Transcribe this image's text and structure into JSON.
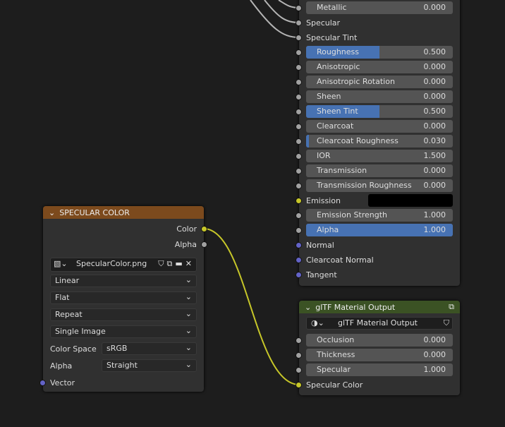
{
  "colors": {
    "grey_socket": "#a1a1a1",
    "yellow_socket": "#c7c729",
    "blue_socket": "#6363c7",
    "value_fill": "#4772b3",
    "image_header": "#7c4a1d",
    "output_header": "#3b5224"
  },
  "bsdf": {
    "rows": [
      {
        "label": "Metallic",
        "type": "field",
        "value": "0.000",
        "fill": 0,
        "socket": "grey"
      },
      {
        "label": "Specular",
        "type": "label",
        "socket": "grey"
      },
      {
        "label": "Specular Tint",
        "type": "label",
        "socket": "grey"
      },
      {
        "label": "Roughness",
        "type": "field",
        "value": "0.500",
        "fill": 0.5,
        "socket": "grey"
      },
      {
        "label": "Anisotropic",
        "type": "field",
        "value": "0.000",
        "fill": 0,
        "socket": "grey"
      },
      {
        "label": "Anisotropic Rotation",
        "type": "field",
        "value": "0.000",
        "fill": 0,
        "socket": "grey"
      },
      {
        "label": "Sheen",
        "type": "field",
        "value": "0.000",
        "fill": 0,
        "socket": "grey"
      },
      {
        "label": "Sheen Tint",
        "type": "field",
        "value": "0.500",
        "fill": 0.5,
        "socket": "grey"
      },
      {
        "label": "Clearcoat",
        "type": "field",
        "value": "0.000",
        "fill": 0,
        "socket": "grey"
      },
      {
        "label": "Clearcoat Roughness",
        "type": "field",
        "value": "0.030",
        "fill": 0.03,
        "socket": "grey"
      },
      {
        "label": "IOR",
        "type": "field",
        "value": "1.500",
        "fill": 0,
        "socket": "grey"
      },
      {
        "label": "Transmission",
        "type": "field",
        "value": "0.000",
        "fill": 0,
        "socket": "grey"
      },
      {
        "label": "Transmission Roughness",
        "type": "field",
        "value": "0.000",
        "fill": 0,
        "socket": "grey"
      },
      {
        "label": "Emission",
        "type": "color",
        "color": "#000000",
        "socket": "yellow"
      },
      {
        "label": "Emission Strength",
        "type": "field",
        "value": "1.000",
        "fill": 0,
        "socket": "grey"
      },
      {
        "label": "Alpha",
        "type": "field",
        "value": "1.000",
        "fill": 1,
        "socket": "grey"
      },
      {
        "label": "Normal",
        "type": "label",
        "socket": "blue"
      },
      {
        "label": "Clearcoat Normal",
        "type": "label",
        "socket": "blue"
      },
      {
        "label": "Tangent",
        "type": "label",
        "socket": "blue"
      }
    ]
  },
  "output": {
    "title": "glTF Material Output",
    "group_name": "glTF Material Output",
    "rows": [
      {
        "label": "Occlusion",
        "type": "field",
        "value": "0.000",
        "fill": 0,
        "socket": "grey"
      },
      {
        "label": "Thickness",
        "type": "field",
        "value": "0.000",
        "fill": 0,
        "socket": "grey"
      },
      {
        "label": "Specular",
        "type": "field",
        "value": "1.000",
        "fill": 0,
        "socket": "grey"
      },
      {
        "label": "Specular Color",
        "type": "label",
        "socket": "yellow"
      }
    ]
  },
  "image": {
    "title": "SPECULAR COLOR",
    "out_color": "Color",
    "out_alpha": "Alpha",
    "filename": "SpecularColor.png",
    "interpolation": "Linear",
    "projection": "Flat",
    "extension": "Repeat",
    "source": "Single Image",
    "color_space_label": "Color Space",
    "color_space": "sRGB",
    "alpha_label": "Alpha",
    "alpha": "Straight",
    "vector": "Vector"
  }
}
